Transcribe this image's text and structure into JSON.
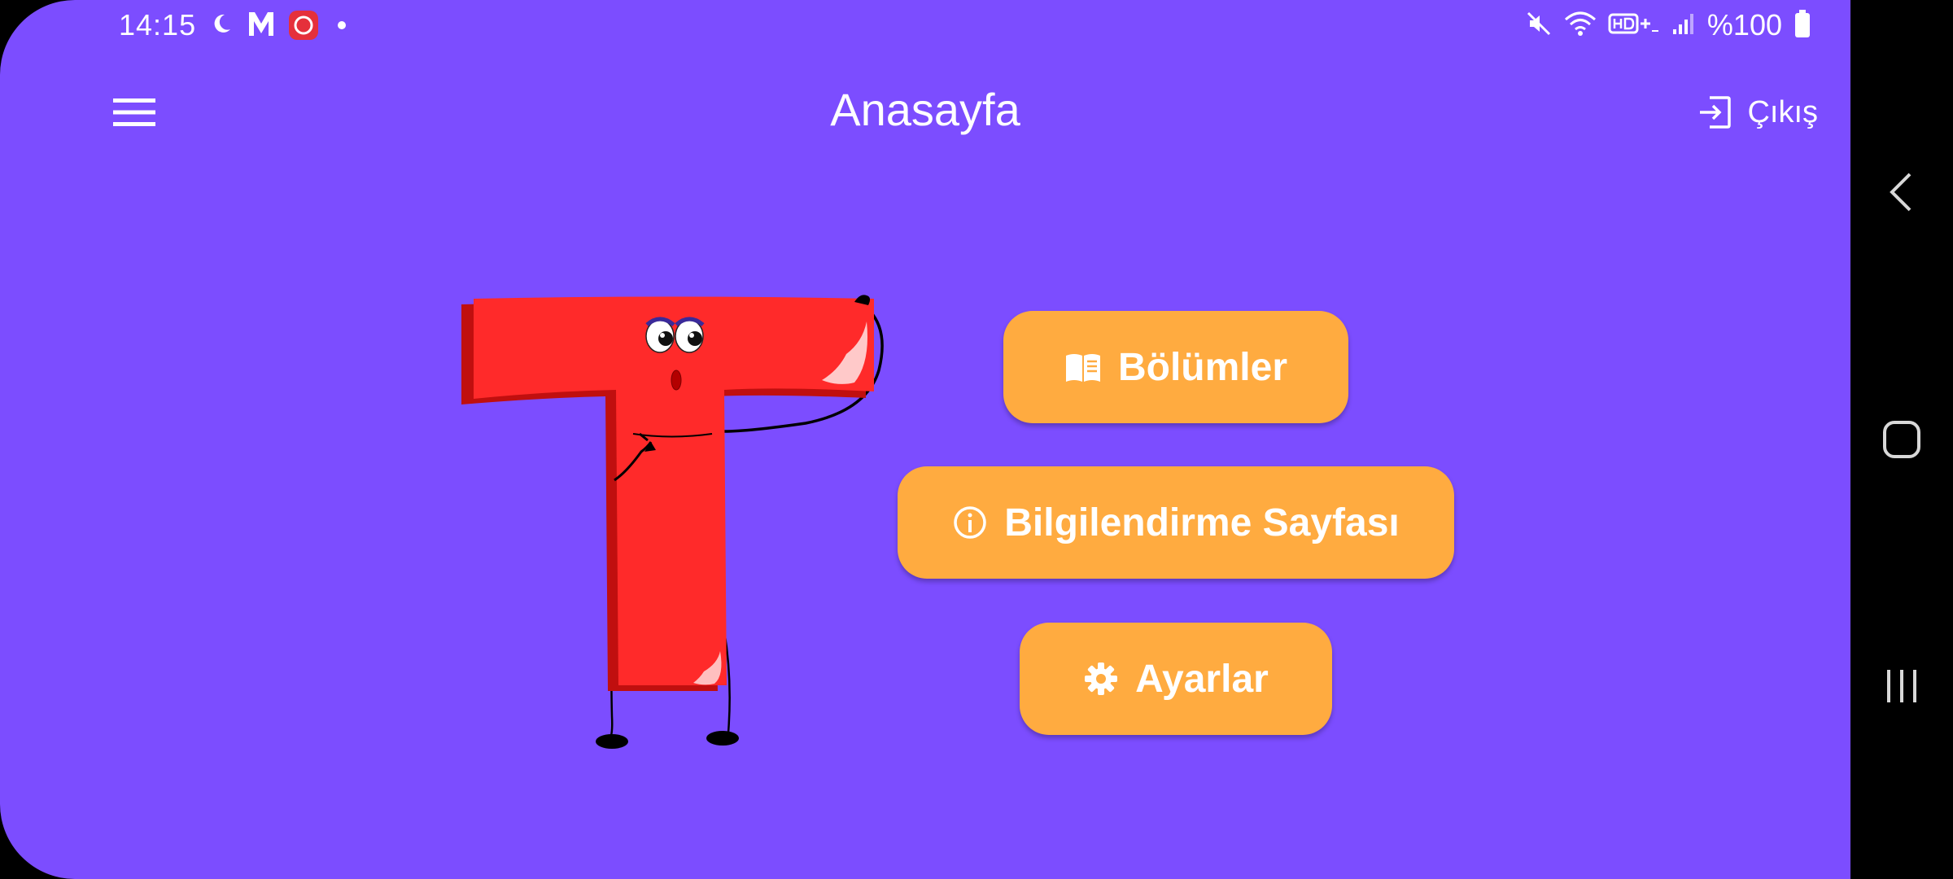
{
  "status_bar": {
    "time": "14:15",
    "battery": "%100",
    "left_icons": [
      "moon-icon",
      "m-app-icon",
      "red-app-icon",
      "notification-dot"
    ],
    "right_icons": [
      "mute-icon",
      "wifi-icon",
      "hd-volte-icon",
      "signal-icon",
      "battery-icon"
    ]
  },
  "app_bar": {
    "title": "Anasayfa",
    "logout_label": "Çıkış",
    "menu_icon": "hamburger-menu-icon",
    "logout_icon": "logout-icon"
  },
  "buttons": [
    {
      "label": "Bölümler",
      "icon": "book-icon"
    },
    {
      "label": "Bilgilendirme Sayfası",
      "icon": "info-icon"
    },
    {
      "label": "Ayarlar",
      "icon": "gear-icon"
    }
  ],
  "colors": {
    "background": "#7c4dff",
    "button": "#ffab40",
    "letter_mascot": "#ff2a2a",
    "text": "#ffffff"
  },
  "navigation_bar": {
    "icons": [
      "back-icon",
      "home-icon",
      "recents-icon"
    ]
  }
}
